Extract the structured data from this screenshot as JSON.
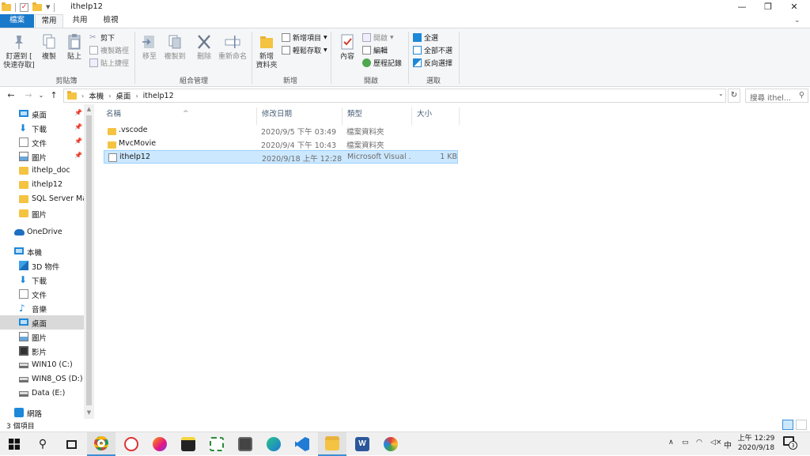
{
  "window": {
    "title": "ithelp12",
    "minimize": "—",
    "maximize": "❐",
    "close": "✕"
  },
  "ribbon_tabs": [
    "檔案",
    "常用",
    "共用",
    "檢視"
  ],
  "ribbon": {
    "clipboard": {
      "pin": "釘選到 [\n快速存取]",
      "copy": "複製",
      "paste": "貼上",
      "cut": "剪下",
      "copy_path": "複製路徑",
      "paste_shortcut": "貼上捷徑",
      "label": "剪貼簿"
    },
    "organize": {
      "move_to": "移至",
      "copy_to": "複製到",
      "delete": "刪除",
      "rename": "重新命名",
      "label": "組合管理"
    },
    "new": {
      "new_folder": "新增\n資料夾",
      "new_item": "新增項目",
      "easy_access": "輕鬆存取",
      "label": "新增"
    },
    "open": {
      "properties": "內容",
      "open": "開啟",
      "edit": "編輯",
      "history": "歷程記錄",
      "label": "開啟"
    },
    "select": {
      "select_all": "全選",
      "select_none": "全部不選",
      "invert": "反向選擇",
      "label": "選取"
    }
  },
  "address": {
    "crumbs": [
      "本機",
      "桌面",
      "ithelp12"
    ],
    "search_placeholder": "搜尋 ithel..."
  },
  "nav_pane": {
    "quick_access": [
      {
        "label": "桌面",
        "icon": "desktop-icon",
        "pinned": true
      },
      {
        "label": "下載",
        "icon": "download-icon",
        "pinned": true
      },
      {
        "label": "文件",
        "icon": "document-icon",
        "pinned": true
      },
      {
        "label": "圖片",
        "icon": "picture-icon",
        "pinned": true
      },
      {
        "label": "ithelp_doc",
        "icon": "folder-icon",
        "pinned": false
      },
      {
        "label": "ithelp12",
        "icon": "folder-icon",
        "pinned": false
      },
      {
        "label": "SQL Server Mar",
        "icon": "folder-icon",
        "pinned": false
      },
      {
        "label": "圖片",
        "icon": "folder-icon",
        "pinned": false
      }
    ],
    "onedrive": "OneDrive",
    "this_pc": "本機",
    "pc_items": [
      {
        "label": "3D 物件",
        "icon": "3d-objects-icon"
      },
      {
        "label": "下載",
        "icon": "download-icon"
      },
      {
        "label": "文件",
        "icon": "document-icon"
      },
      {
        "label": "音樂",
        "icon": "music-icon"
      },
      {
        "label": "桌面",
        "icon": "desktop-icon"
      },
      {
        "label": "圖片",
        "icon": "picture-icon"
      },
      {
        "label": "影片",
        "icon": "video-icon"
      },
      {
        "label": "WIN10 (C:)",
        "icon": "drive-icon"
      },
      {
        "label": "WIN8_OS (D:)",
        "icon": "drive-icon"
      },
      {
        "label": "Data (E:)",
        "icon": "drive-icon"
      }
    ],
    "network": "網路"
  },
  "columns": [
    "名稱",
    "修改日期",
    "類型",
    "大小"
  ],
  "files": [
    {
      "name": ".vscode",
      "date": "2020/9/5 下午 03:49",
      "type": "檔案資料夾",
      "size": "",
      "kind": "folder"
    },
    {
      "name": "MvcMovie",
      "date": "2020/9/4 下午 10:43",
      "type": "檔案資料夾",
      "size": "",
      "kind": "folder"
    },
    {
      "name": "ithelp12",
      "date": "2020/9/18 上午 12:28",
      "type": "Microsoft Visual ...",
      "size": "1 KB",
      "kind": "file"
    }
  ],
  "status": {
    "item_count": "3 個項目"
  },
  "taskbar": {
    "ime": "中",
    "time": "上午 12:29",
    "date": "2020/9/18",
    "notifications": "3"
  },
  "colors": {
    "accent": "#1979ca",
    "selection": "#cce8ff",
    "folder": "#f5c342"
  }
}
